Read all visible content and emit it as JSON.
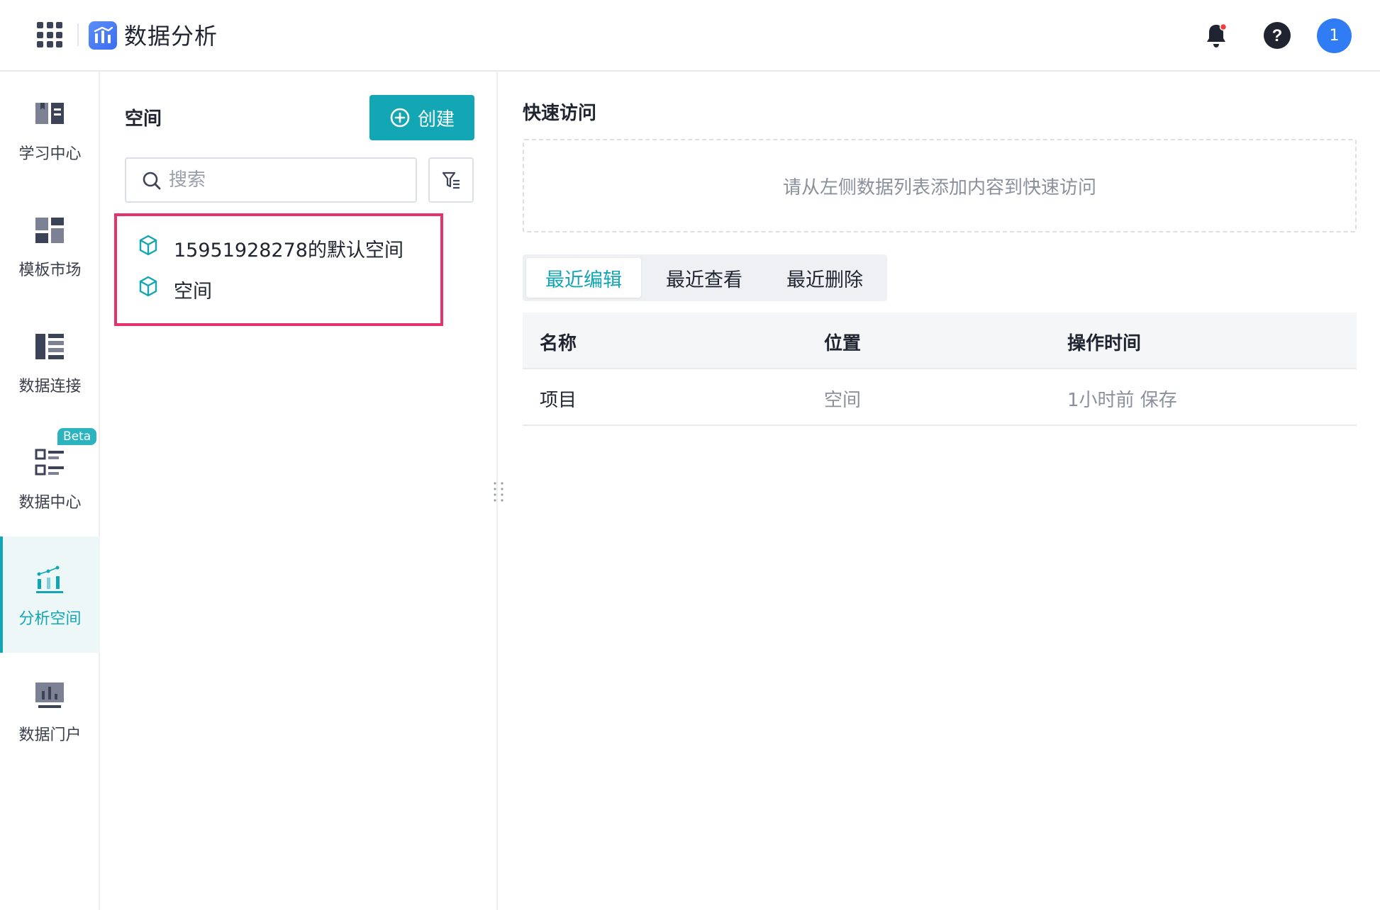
{
  "header": {
    "app_title": "数据分析",
    "apps_icon": "grid-apps-icon",
    "notification_icon": "bell-icon",
    "help_icon": "question-icon",
    "avatar_text": "1"
  },
  "colors": {
    "accent": "#12a5b4",
    "avatar": "#2f7cf5",
    "highlight_border": "#e6336e",
    "beta_badge": "#2bb3bf"
  },
  "leftnav": {
    "items": [
      {
        "label": "学习中心",
        "icon": "book-icon"
      },
      {
        "label": "模板市场",
        "icon": "template-icon"
      },
      {
        "label": "数据连接",
        "icon": "data-connect-icon"
      },
      {
        "label": "数据中心",
        "icon": "data-center-icon",
        "badge": "Beta"
      },
      {
        "label": "分析空间",
        "icon": "analysis-space-icon",
        "active": true
      },
      {
        "label": "数据门户",
        "icon": "data-portal-icon"
      }
    ]
  },
  "spaces_panel": {
    "title": "空间",
    "create_label": "创建",
    "search_placeholder": "搜索",
    "items": [
      {
        "label": "15951928278的默认空间",
        "icon": "cube-icon"
      },
      {
        "label": "空间",
        "icon": "cube-icon"
      }
    ]
  },
  "quick_access": {
    "title": "快速访问",
    "empty_text": "请从左侧数据列表添加内容到快速访问"
  },
  "recent": {
    "tabs": [
      "最近编辑",
      "最近查看",
      "最近删除"
    ],
    "active_tab": 0,
    "columns": [
      "名称",
      "位置",
      "操作时间"
    ],
    "rows": [
      {
        "name": "项目",
        "location": "空间",
        "time": "1小时前 保存"
      }
    ]
  }
}
